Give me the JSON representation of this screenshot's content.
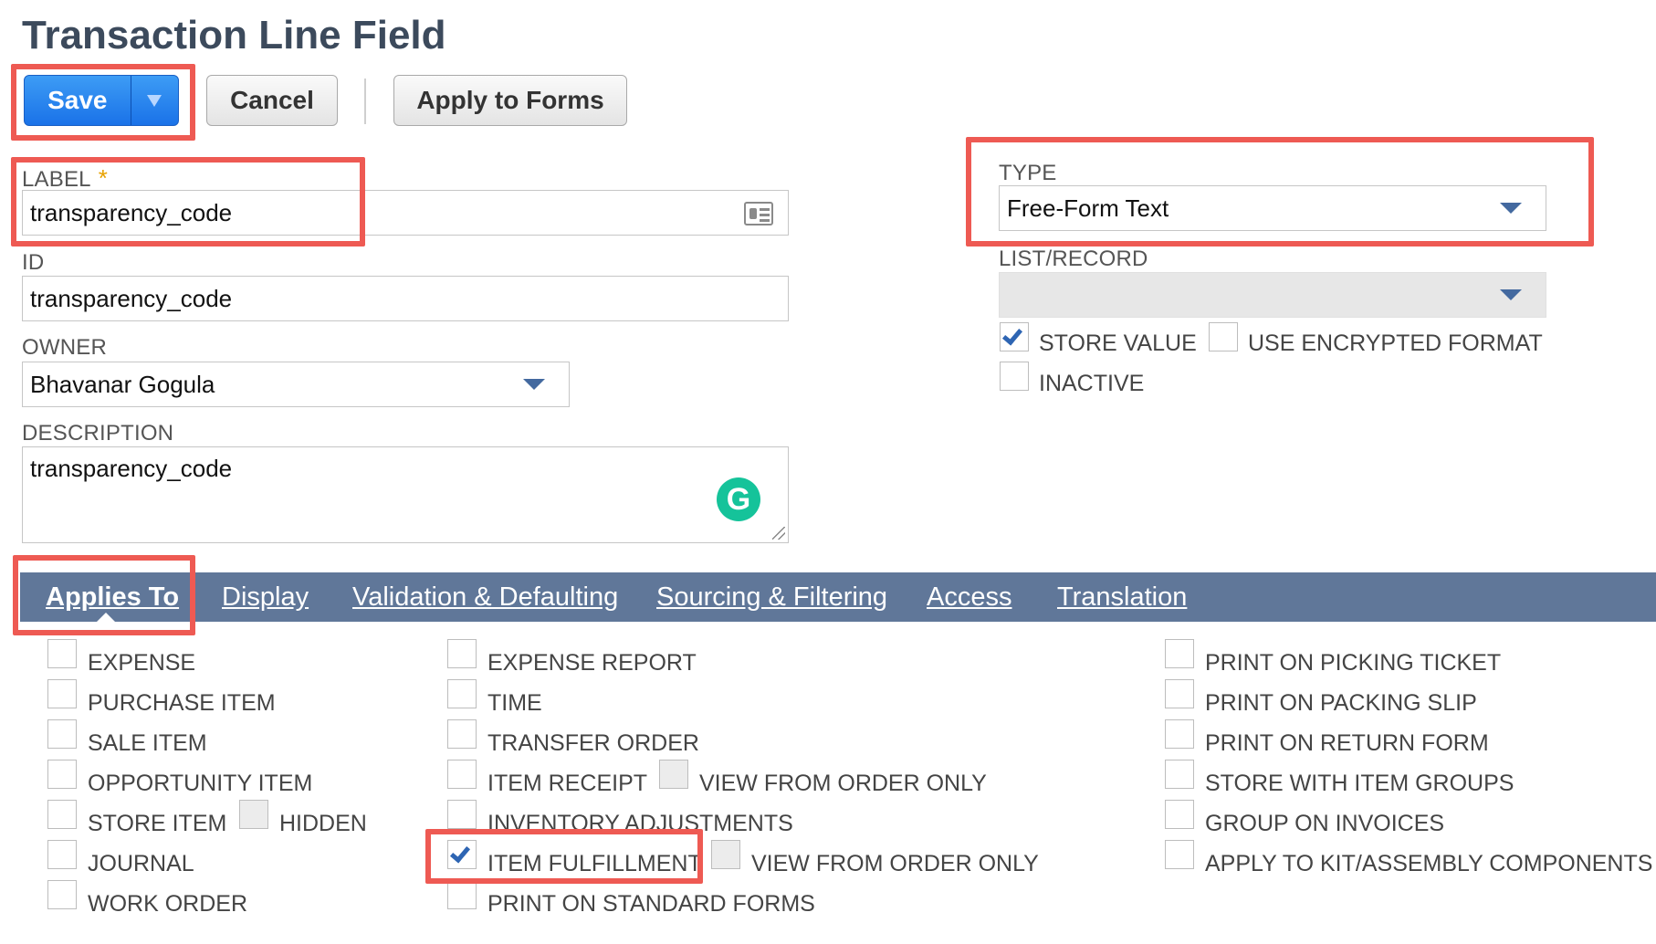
{
  "page": {
    "title": "Transaction Line Field"
  },
  "toolbar": {
    "save_label": "Save",
    "cancel_label": "Cancel",
    "apply_label": "Apply to Forms"
  },
  "form": {
    "label": {
      "label": "LABEL",
      "required": "*",
      "value": "transparency_code"
    },
    "id": {
      "label": "ID",
      "value": "transparency_code"
    },
    "owner": {
      "label": "OWNER",
      "value": "Bhavanar Gogula"
    },
    "description": {
      "label": "DESCRIPTION",
      "value": "transparency_code"
    },
    "type": {
      "label": "TYPE",
      "value": "Free-Form Text"
    },
    "list_record": {
      "label": "LIST/RECORD",
      "value": ""
    },
    "store_value": {
      "label": "STORE VALUE",
      "checked": true
    },
    "use_encrypted": {
      "label": "USE ENCRYPTED FORMAT",
      "checked": false
    },
    "inactive": {
      "label": "INACTIVE",
      "checked": false
    }
  },
  "tabs": [
    {
      "label": "Applies To",
      "active": true
    },
    {
      "label": "Display"
    },
    {
      "label": "Validation & Defaulting"
    },
    {
      "label": "Sourcing & Filtering"
    },
    {
      "label": "Access"
    },
    {
      "label": "Translation"
    }
  ],
  "applies_to": {
    "col1": [
      "EXPENSE",
      "PURCHASE ITEM",
      "SALE ITEM",
      "OPPORTUNITY ITEM",
      "STORE ITEM",
      "JOURNAL",
      "WORK ORDER"
    ],
    "store_item_hidden": "HIDDEN",
    "col2": [
      "EXPENSE REPORT",
      "TIME",
      "TRANSFER ORDER",
      "ITEM RECEIPT",
      "INVENTORY ADJUSTMENTS",
      "ITEM FULFILLMENT",
      "PRINT ON STANDARD FORMS"
    ],
    "item_receipt_view": "VIEW FROM ORDER ONLY",
    "item_fulfillment_view": "VIEW FROM ORDER ONLY",
    "item_fulfillment_checked": true,
    "col3": [
      "PRINT ON PICKING TICKET",
      "PRINT ON PACKING SLIP",
      "PRINT ON RETURN FORM",
      "STORE WITH ITEM GROUPS",
      "GROUP ON INVOICES",
      "APPLY TO KIT/ASSEMBLY COMPONENTS"
    ]
  },
  "colors": {
    "highlight": "#ee5a53",
    "tabbar": "#607799",
    "save": "#1a72e8"
  }
}
